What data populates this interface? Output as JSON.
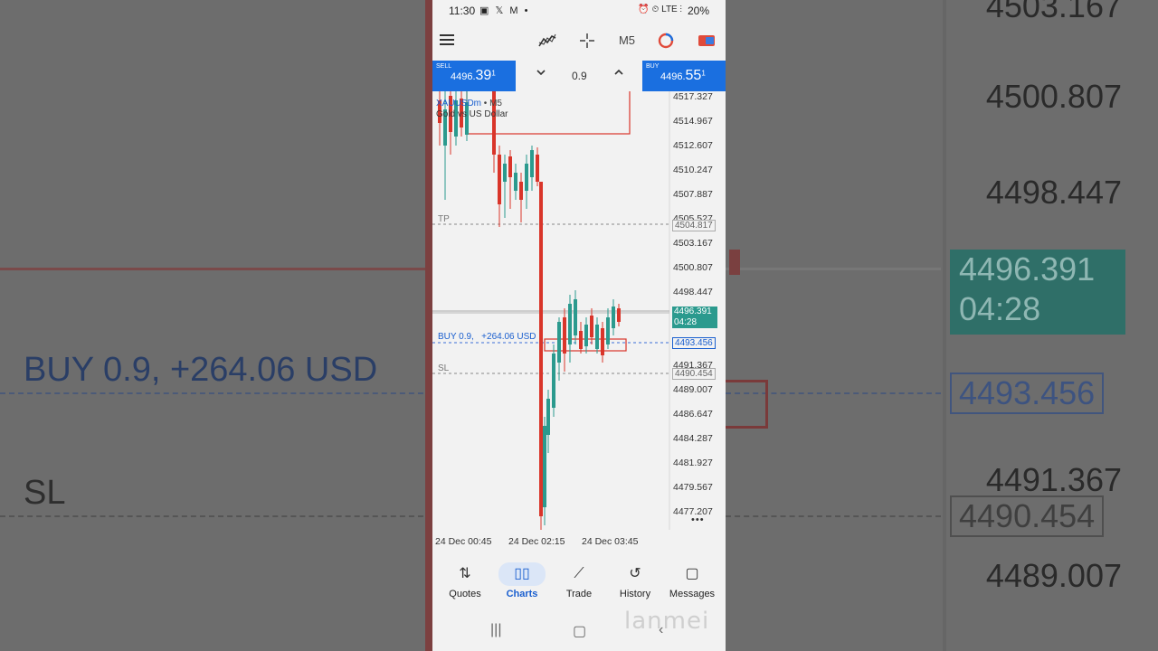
{
  "backdrop": {
    "left_label": "BUY 0.9,   +264.06 USD",
    "left_sl": "SL",
    "right_prices": [
      "4503.167",
      "4500.807",
      "4498.447",
      "4491.367",
      "4489.007"
    ],
    "right_tag_price": "4496.391",
    "right_tag_time": "04:28",
    "right_box_blue": "4493.456",
    "right_box_grey": "4490.454"
  },
  "status": {
    "time": "11:30",
    "left_icons": "▣ 𝕏 M •",
    "right_icons": "⏰ ⏲ LTE ⫶",
    "battery": "20%"
  },
  "toolbar": {
    "menu_icon": "menu-icon",
    "indicator_icon": "indicator-icon",
    "crosshair_icon": "crosshair-icon",
    "timeframe": "M5",
    "chart_type_icon": "chart-type-icon",
    "account_icon": "account-icon"
  },
  "trade": {
    "sell_label": "SELL",
    "sell_price_prefix": "4496.",
    "sell_price_big": "39",
    "sell_price_sup": "1",
    "buy_label": "BUY",
    "buy_price_prefix": "4496.",
    "buy_price_big": "55",
    "buy_price_sup": "1",
    "volume": "0.9"
  },
  "chart": {
    "symbol": "XAUUSDm",
    "timeframe": "M5",
    "description": "Gold vs US Dollar",
    "tp_label": "TP",
    "sl_label": "SL",
    "position_label": "BUY 0.9,   +264.06 USD",
    "price_axis": [
      "4517.327",
      "4514.967",
      "4512.607",
      "4510.247",
      "4507.887",
      "4505.527",
      "4503.167",
      "4500.807",
      "4498.447",
      "4493.456",
      "4491.367",
      "4489.007",
      "4486.647",
      "4484.287",
      "4481.927",
      "4479.567",
      "4477.207"
    ],
    "tp_price": "4504.817",
    "bid_price": "4496.391",
    "bid_time": "04:28",
    "entry_price": "4493.456",
    "sl_price": "4490.454",
    "time_axis": [
      "24 Dec 00:45",
      "24 Dec 02:15",
      "24 Dec 03:45"
    ],
    "more": "•••"
  },
  "nav": [
    {
      "label": "Quotes",
      "icon": "⇅"
    },
    {
      "label": "Charts",
      "icon": "▯▯"
    },
    {
      "label": "Trade",
      "icon": "⟋"
    },
    {
      "label": "History",
      "icon": "↺"
    },
    {
      "label": "Messages",
      "icon": "▢"
    }
  ],
  "watermark": "lanmei"
}
